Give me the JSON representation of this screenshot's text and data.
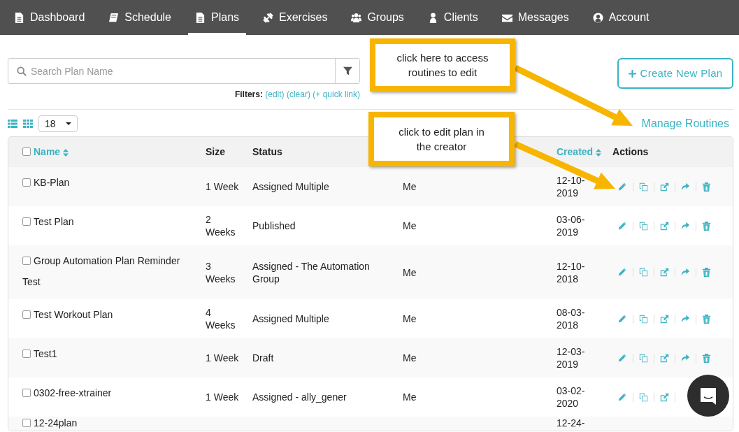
{
  "nav": [
    {
      "label": "Dashboard",
      "selected": false
    },
    {
      "label": "Schedule",
      "selected": false
    },
    {
      "label": "Plans",
      "selected": true
    },
    {
      "label": "Exercises",
      "selected": false
    },
    {
      "label": "Groups",
      "selected": false
    },
    {
      "label": "Clients",
      "selected": false
    },
    {
      "label": "Messages",
      "selected": false
    },
    {
      "label": "Account",
      "selected": false
    }
  ],
  "search": {
    "placeholder": "Search Plan Name"
  },
  "filters": {
    "label": "Filters:",
    "links": [
      "(edit)",
      "(clear)",
      "(+ quick link)"
    ]
  },
  "create_button": "Create New Plan",
  "page_size": "18",
  "manage_link": "Manage Routines",
  "callouts": [
    {
      "text": "click here to access routines to edit"
    },
    {
      "text": "click to edit plan in the creator"
    }
  ],
  "table": {
    "header_checkbox": {
      "checked": false
    },
    "columns": [
      {
        "label": "Name",
        "sortable": true
      },
      {
        "label": "Size",
        "sortable": false
      },
      {
        "label": "Status",
        "sortable": false
      },
      {
        "sortable": false
      },
      {
        "label": "Created",
        "sortable": true
      },
      {
        "label": "Actions",
        "sortable": false
      }
    ],
    "rows": [
      {
        "name": "KB-Plan",
        "checked": false,
        "size": "1 Week",
        "status": "Assigned Multiple",
        "column_4": "Me",
        "created": "12-10-2019"
      },
      {
        "name": "Test Plan",
        "checked": false,
        "size": "2 Weeks",
        "status": "Published",
        "column_4": "Me",
        "created": "03-06-2019"
      },
      {
        "name": "Group Automation Plan Reminder Test",
        "checked": false,
        "size": "3 Weeks",
        "status": "Assigned - The Automation Group",
        "column_4": "Me",
        "created": "12-10-2018"
      },
      {
        "name": "Test Workout Plan",
        "checked": false,
        "size": "4 Weeks",
        "status": "Assigned Multiple",
        "column_4": "Me",
        "created": "08-03-2018"
      },
      {
        "name": "Test1",
        "checked": false,
        "size": "1 Week",
        "status": "Draft",
        "column_4": "Me",
        "created": "12-03-2019"
      },
      {
        "name": "0302-free-xtrainer",
        "checked": false,
        "size": "1 Week",
        "status": "Assigned - ally_gener",
        "column_4": "Me",
        "created": "03-02-2020"
      },
      {
        "name": "12-24plan",
        "checked": false,
        "created": "12-24-"
      }
    ]
  }
}
